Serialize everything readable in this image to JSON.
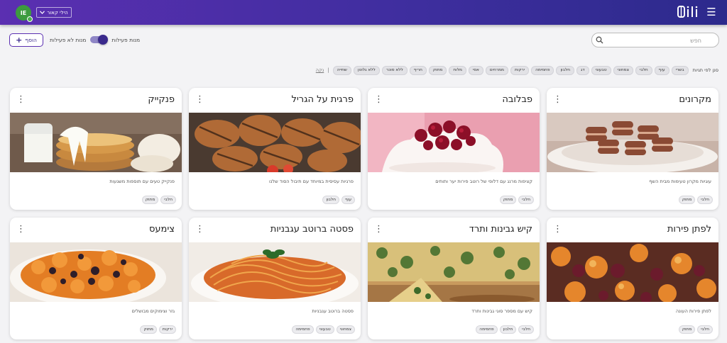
{
  "header": {
    "user_initials": "IE",
    "user_select_label": "הילי קאור",
    "menu_icon": "hamburger-icon",
    "logo_icon": "brand-logo"
  },
  "search": {
    "placeholder": "חפש",
    "value": ""
  },
  "toolbar": {
    "add_label": "הוסף",
    "active_label": "מנות פעילות",
    "inactive_label": "מנות לא פעילות",
    "active_toggle_on": true,
    "accent_color": "#3a2a8c"
  },
  "filters": {
    "label": "סנן לפי תגיות",
    "tags": [
      "בשרי",
      "עוף",
      "חלבי",
      "צמחוני",
      "טבעוני",
      "דג",
      "חלבון",
      "פחמימה",
      "ירקות",
      "ממרחים",
      "אסי",
      "מלוח",
      "מתוק",
      "חריף",
      "ללא סוכר",
      "ללא גלוטן",
      "שתייה"
    ],
    "clear_label": "נקה"
  },
  "cards": [
    {
      "title": "מקרונים",
      "desc": "עוגיות מקרון טעימות מבית השף",
      "tags": [
        "חלבי",
        "מתוק"
      ]
    },
    {
      "title": "פבלובה",
      "desc": "קציפות מרנג עם דלופי של רוטב פירות יער ותותים",
      "tags": [
        "חלבי",
        "מתוק"
      ]
    },
    {
      "title": "פרגית על הגריל",
      "desc": "פרגיות עסיסית במיוחד עם תיבול הסוד שלנו",
      "tags": [
        "עוף",
        "חלבון"
      ]
    },
    {
      "title": "פנקייק",
      "desc": "פנקייק טעים עם תוספות משגעות",
      "tags": [
        "חלבי",
        "מתוק"
      ]
    },
    {
      "title": "לפתן פירות",
      "desc": "לפתן פירות העונה",
      "tags": [
        "חלבי",
        "מתוק"
      ]
    },
    {
      "title": "קיש גבינות ותרד",
      "desc": "קיש עם מספר סוגי גבינות ותרד",
      "tags": [
        "חלבי",
        "חלבון",
        "פחמימה"
      ]
    },
    {
      "title": "פסטה ברוטב עגבניות",
      "desc": "פסטה ברוטב עגבניות",
      "tags": [
        "צמחוני",
        "טבעוני",
        "פחמימה"
      ]
    },
    {
      "title": "צימעס",
      "desc": "גזר וצימוקים מבושלים",
      "tags": [
        "ירקות",
        "מתוק"
      ]
    }
  ]
}
